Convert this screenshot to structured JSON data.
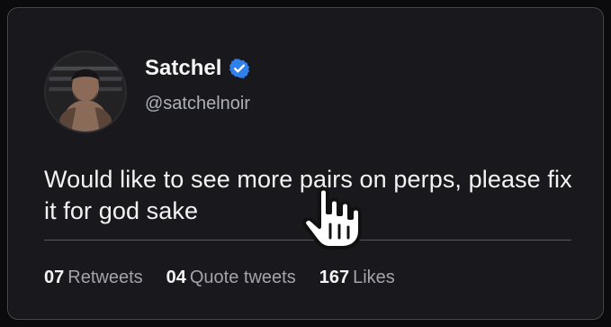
{
  "profile": {
    "name": "Satchel",
    "handle": "@satchelnoir"
  },
  "tweet": {
    "text": "Would like to see more pairs on perps, please fix it for god sake"
  },
  "stats": [
    {
      "value": "07",
      "label": "Retweets"
    },
    {
      "value": "04",
      "label": "Quote tweets"
    },
    {
      "value": "167",
      "label": "Likes"
    }
  ],
  "icons": {
    "verified": "verified-badge-icon",
    "cursor": "pointer-hand-icon"
  },
  "colors": {
    "background": "#19191d",
    "verified": "#2f80ed",
    "text": "#f3f3f4",
    "muted": "#a3a4aa"
  }
}
